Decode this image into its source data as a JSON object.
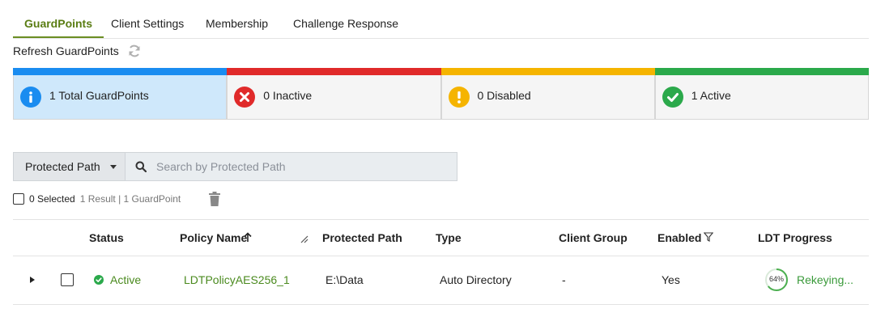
{
  "tabs": [
    {
      "label": "GuardPoints",
      "active": true
    },
    {
      "label": "Client Settings",
      "active": false
    },
    {
      "label": "Membership",
      "active": false
    },
    {
      "label": "Challenge Response",
      "active": false
    }
  ],
  "refresh_label": "Refresh GuardPoints",
  "summary_cards": [
    {
      "label": "1 Total GuardPoints",
      "color": "#1a8cf0",
      "icon": "info-icon",
      "selected": true
    },
    {
      "label": "0 Inactive",
      "color": "#e02a2a",
      "icon": "error-x-icon"
    },
    {
      "label": "0 Disabled",
      "color": "#f5b400",
      "icon": "warning-icon"
    },
    {
      "label": "1 Active",
      "color": "#2ba94b",
      "icon": "check-icon"
    }
  ],
  "filter": {
    "field": "Protected Path",
    "search_placeholder": "Search by Protected Path",
    "search_value": ""
  },
  "selection": {
    "selected": "0 Selected",
    "summary": "1 Result | 1 GuardPoint"
  },
  "table": {
    "columns": [
      "Status",
      "Policy Name",
      "Protected Path",
      "Type",
      "Client Group",
      "Enabled",
      "LDT Progress"
    ],
    "rows": [
      {
        "status": "Active",
        "policy_name": "LDTPolicyAES256_1",
        "protected_path": "E:\\Data",
        "type": "Auto Directory",
        "client_group": "-",
        "enabled": "Yes",
        "ldt_percent": "64%",
        "ldt_status": "Rekeying..."
      }
    ]
  },
  "colors": {
    "accent_green": "#6b8e23",
    "active_green": "#2ba94b"
  }
}
